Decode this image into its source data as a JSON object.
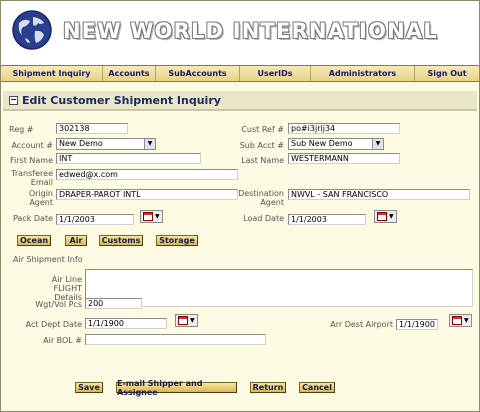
{
  "header": {
    "company": "NEW WORLD INTERNATIONAL"
  },
  "nav": [
    "Shipment Inquiry",
    "Accounts",
    "SubAccounts",
    "UserIDs",
    "Administrators",
    "Sign Out"
  ],
  "page_title": "Edit Customer Shipment Inquiry",
  "collapse_symbol": "−",
  "form": {
    "reg_label": "Reg #",
    "reg_value": "302138",
    "account_label": "Account #",
    "account_value": "New Demo",
    "first_name_label": "First Name",
    "first_name_value": "INT",
    "transferee_email_label": "Transferee Email",
    "transferee_email_value": "edwed@x.com",
    "origin_agent_label": "Origin Agent",
    "origin_agent_value": "DRAPER-PAROT INTL",
    "pack_date_label": "Pack Date",
    "pack_date_value": "1/1/2003",
    "cust_ref_label": "Cust Ref #",
    "cust_ref_value": "po#i3jrij34",
    "sub_acct_label": "Sub Acct #",
    "sub_acct_value": "Sub New Demo",
    "last_name_label": "Last Name",
    "last_name_value": "WESTERMANN",
    "destination_agent_label": "Destination Agent",
    "destination_agent_value": "NWVL - SAN FRANCISCO",
    "load_date_label": "Load Date",
    "load_date_value": "1/1/2003"
  },
  "mode_buttons": [
    "Ocean",
    "Air",
    "Customs",
    "Storage"
  ],
  "air_info": {
    "section_title": "Air Shipment Info",
    "flight_label": "Air Line FLIGHT Details",
    "flight_value": "",
    "wgt_label": "Wgt/Vol Pcs",
    "wgt_value": "200",
    "act_dept_label": "Act Dept Date",
    "act_dept_value": "1/1/1900",
    "arr_dest_label": "Arr Dest Airport",
    "arr_dest_value": "1/1/1900",
    "bol_label": "Air BOL #",
    "bol_value": ""
  },
  "actions": [
    "Save",
    "E-mail Shipper and Assignee",
    "Return",
    "Cancel"
  ]
}
